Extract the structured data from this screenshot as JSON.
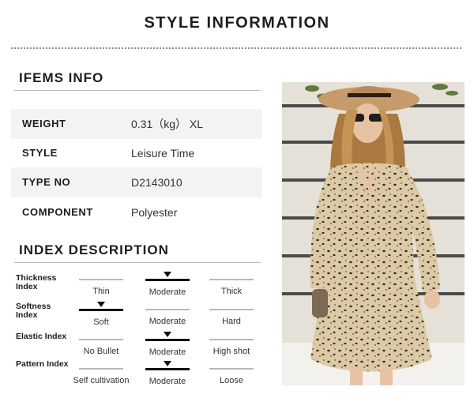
{
  "header": {
    "title": "STYLE INFORMATION"
  },
  "items_info": {
    "title": "IFEMS INFO",
    "rows": [
      {
        "label": "WEIGHT",
        "value": "0.31（kg） XL"
      },
      {
        "label": "STYLE",
        "value": "Leisure Time"
      },
      {
        "label": "TYPE NO",
        "value": "D2143010"
      },
      {
        "label": "COMPONENT",
        "value": "Polyester"
      }
    ]
  },
  "index_description": {
    "title": "INDEX DESCRIPTION",
    "indices": [
      {
        "label": "Thickness Index",
        "options": [
          "Thin",
          "Moderate",
          "Thick"
        ],
        "selected": "Moderate"
      },
      {
        "label": "Softness Index",
        "options": [
          "Soft",
          "Moderate",
          "Hard"
        ],
        "selected": "Soft"
      },
      {
        "label": "Elastic Index",
        "options": [
          "No Bullet",
          "Moderate",
          "High shot"
        ],
        "selected": "Moderate"
      },
      {
        "label": "Pattern Index",
        "options": [
          "Self cultivation",
          "Moderate",
          "Loose"
        ],
        "selected": "Moderate"
      }
    ]
  },
  "photo": {
    "subject": "woman in leopard print dress and tan hat",
    "colors": {
      "wall": "#e9e4dc",
      "dress": "#d9c6a3",
      "spots": "#3a2b1d",
      "hat": "#c79a6b"
    }
  }
}
